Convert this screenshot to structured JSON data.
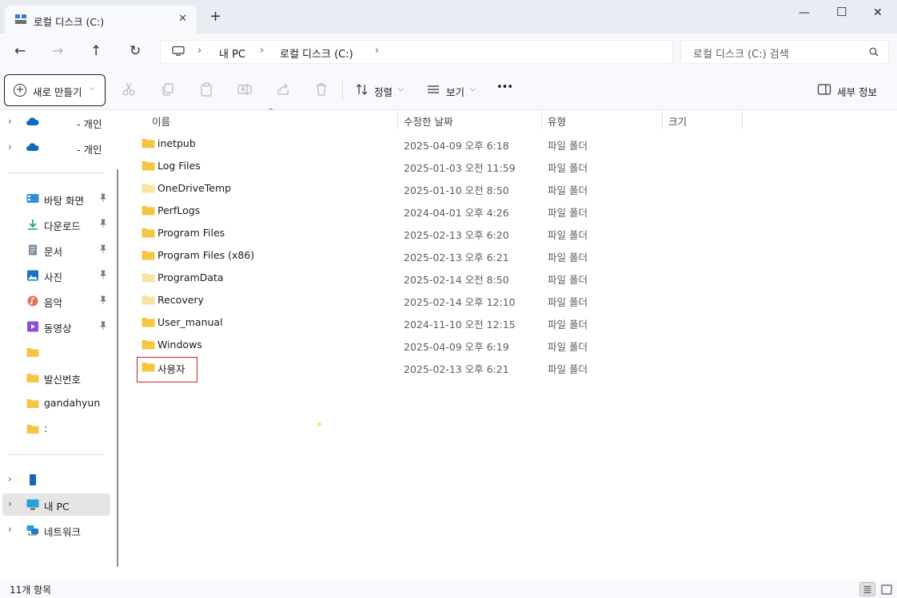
{
  "window": {
    "tab_title": "로컬 디스크 (C:)",
    "tab_close": "✕",
    "new_tab": "+",
    "minimize": "—",
    "maximize": "☐",
    "close": "✕"
  },
  "nav": {
    "back": "←",
    "forward": "→",
    "up": "↑",
    "refresh": "↻"
  },
  "address": {
    "sep": "›",
    "crumbs": [
      "내 PC",
      "로컬 디스크 (C:)"
    ]
  },
  "search": {
    "placeholder": "로컬 디스크 (C:) 검색"
  },
  "toolbar": {
    "new_label": "새로 만들기",
    "sort_label": "정렬",
    "view_label": "보기",
    "more": "•••",
    "details_label": "세부 정보",
    "chevron": "⌵",
    "plus": "+"
  },
  "sidebar": {
    "expander": "›",
    "cloud": [
      {
        "label": "- 개인"
      },
      {
        "label": "- 개인"
      }
    ],
    "quick": [
      {
        "label": "바탕 화면",
        "icon": "desktop-icon"
      },
      {
        "label": "다운로드",
        "icon": "download-icon"
      },
      {
        "label": "문서",
        "icon": "documents-icon"
      },
      {
        "label": "사진",
        "icon": "pictures-icon"
      },
      {
        "label": "음악",
        "icon": "music-icon"
      },
      {
        "label": "동영상",
        "icon": "videos-icon"
      },
      {
        "label": "",
        "icon": "folder-icon"
      },
      {
        "label": "발신번호",
        "icon": "folder-icon"
      },
      {
        "label": "gandahyun",
        "icon": "folder-icon"
      },
      {
        "label": ":",
        "icon": "folder-icon"
      }
    ],
    "device": {
      "label": ""
    },
    "this_pc": {
      "label": "내 PC"
    },
    "network": {
      "label": "네트워크"
    }
  },
  "columns": {
    "name": "이름",
    "date": "수정한 날짜",
    "type": "유형",
    "size": "크기",
    "sort_arrow": "^"
  },
  "files": [
    {
      "name": "inetpub",
      "date": "2025-04-09 오후 6:18",
      "type": "파일 폴더",
      "pale": false
    },
    {
      "name": "Log Files",
      "date": "2025-01-03 오전 11:59",
      "type": "파일 폴더",
      "pale": false
    },
    {
      "name": "OneDriveTemp",
      "date": "2025-01-10 오전 8:50",
      "type": "파일 폴더",
      "pale": true
    },
    {
      "name": "PerfLogs",
      "date": "2024-04-01 오후 4:26",
      "type": "파일 폴더",
      "pale": false
    },
    {
      "name": "Program Files",
      "date": "2025-02-13 오후 6:20",
      "type": "파일 폴더",
      "pale": false
    },
    {
      "name": "Program Files (x86)",
      "date": "2025-02-13 오후 6:21",
      "type": "파일 폴더",
      "pale": false
    },
    {
      "name": "ProgramData",
      "date": "2025-02-14 오전 8:50",
      "type": "파일 폴더",
      "pale": true
    },
    {
      "name": "Recovery",
      "date": "2025-02-14 오후 12:10",
      "type": "파일 폴더",
      "pale": true
    },
    {
      "name": "User_manual",
      "date": "2024-11-10 오전 12:15",
      "type": "파일 폴더",
      "pale": false
    },
    {
      "name": "Windows",
      "date": "2025-04-09 오후 6:19",
      "type": "파일 폴더",
      "pale": false
    },
    {
      "name": "사용자",
      "date": "2025-02-13 오후 6:21",
      "type": "파일 폴더",
      "pale": false
    }
  ],
  "status": {
    "item_count": "11개 항목"
  },
  "colors": {
    "folder": "#f4c542",
    "folder_pale": "#f8e3a3",
    "highlight": "#d0202a",
    "selected_bg": "#e5e5e5"
  }
}
